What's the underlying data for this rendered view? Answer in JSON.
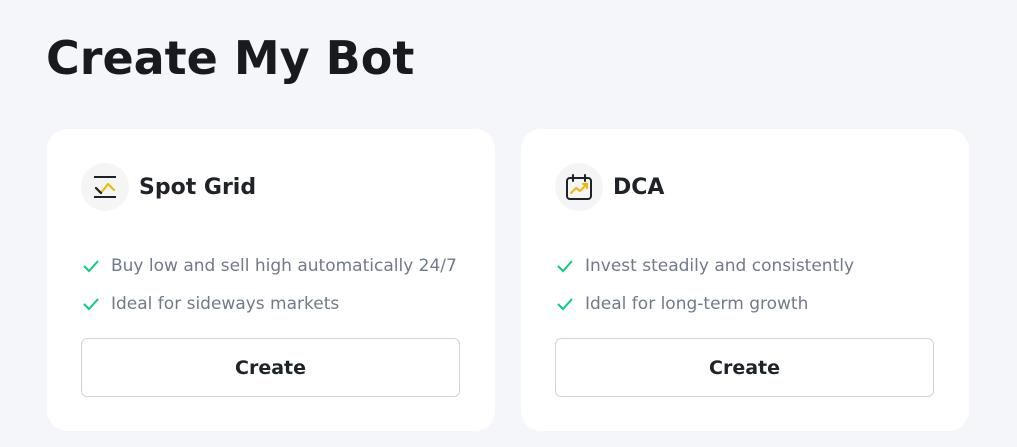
{
  "page": {
    "title": "Create My Bot"
  },
  "cards": [
    {
      "title": "Spot Grid",
      "icon": "spot-grid-icon",
      "features": [
        "Buy low and sell high automatically 24/7",
        "Ideal for sideways markets"
      ],
      "button_label": "Create"
    },
    {
      "title": "DCA",
      "icon": "calendar-chart-icon",
      "features": [
        "Invest steadily and consistently",
        "Ideal for long-term growth"
      ],
      "button_label": "Create"
    }
  ],
  "colors": {
    "background": "#f5f6fa",
    "card": "#ffffff",
    "accent": "#f0b90b",
    "check": "#0ecb81",
    "text_primary": "#1e2329",
    "text_secondary": "#707a8a"
  }
}
